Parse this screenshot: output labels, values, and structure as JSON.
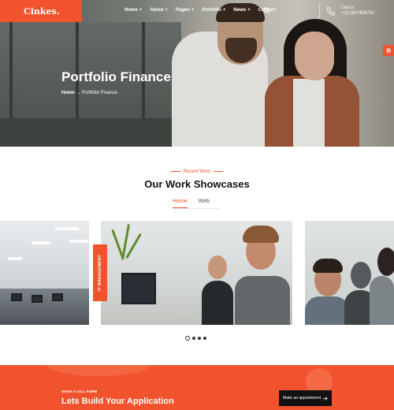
{
  "brand": {
    "logo": "Cinkes.",
    "accent": "#f0532d"
  },
  "nav": {
    "items": [
      {
        "label": "Home",
        "has_submenu": true
      },
      {
        "label": "About",
        "has_submenu": true
      },
      {
        "label": "Pages",
        "has_submenu": true
      },
      {
        "label": "Portfolio",
        "has_submenu": true
      },
      {
        "label": "News",
        "has_submenu": true
      },
      {
        "label": "Contact",
        "has_submenu": false
      }
    ],
    "submenu_marker": "+",
    "search_icon": "search-icon"
  },
  "contact": {
    "label": "Call Us",
    "phone": "+12-987456741",
    "icon": "phone-icon"
  },
  "hero": {
    "title": "Portfolio Finance",
    "breadcrumb": {
      "home": "Home",
      "separator": "→",
      "current": "Portfolio Finance"
    }
  },
  "settings": {
    "icon": "gear-icon"
  },
  "section": {
    "eyebrow": "Recent Work",
    "title": "Our Work Showcases",
    "tabs": [
      {
        "label": "Home",
        "active": true
      },
      {
        "label": "Web",
        "active": false
      }
    ]
  },
  "portfolio": {
    "tag": "IT MANAGEMENT",
    "slides": 4,
    "active_slide": 1
  },
  "cta": {
    "label": "MAKE A CALL FORM",
    "title": "Lets Build Your Application",
    "button": "Make an appointment",
    "button_icon": "arrow-right-icon"
  }
}
